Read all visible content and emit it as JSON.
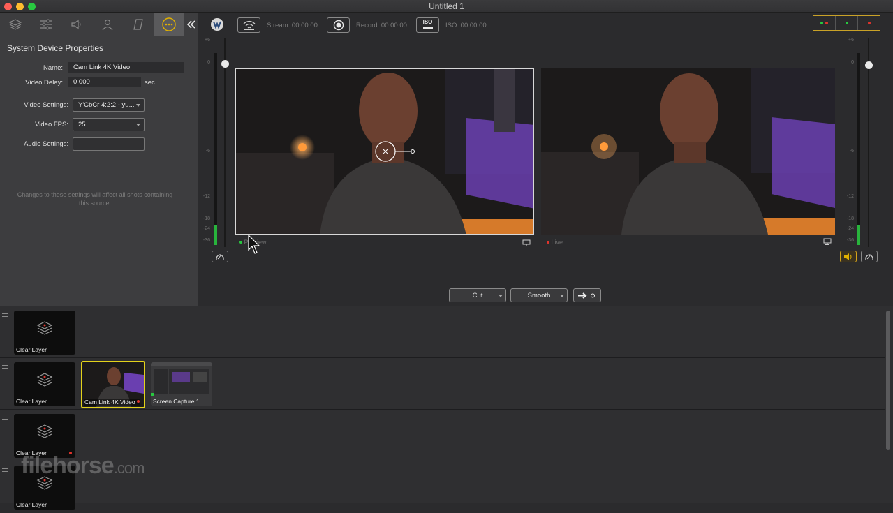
{
  "window": {
    "title": "Untitled 1"
  },
  "left_tabs": [
    {
      "icon": "layers-icon"
    },
    {
      "icon": "sliders-icon"
    },
    {
      "icon": "audio-icon"
    },
    {
      "icon": "person-icon"
    },
    {
      "icon": "overlay-icon"
    },
    {
      "icon": "more-icon",
      "active": true
    }
  ],
  "properties": {
    "title": "System Device Properties",
    "name_label": "Name:",
    "name_value": "Cam Link 4K Video",
    "delay_label": "Video Delay:",
    "delay_value": "0.000",
    "delay_unit": "sec",
    "settings_label": "Video Settings:",
    "settings_value": "Y'CbCr 4:2:2 - yu...",
    "fps_label": "Video FPS:",
    "fps_value": "25",
    "audio_label": "Audio Settings:",
    "audio_value": "",
    "note": "Changes to these settings will affect all shots containing this source."
  },
  "toolbar": {
    "stream_label": "Stream:",
    "stream_time": "00:00:00",
    "record_label": "Record:",
    "record_time": "00:00:00",
    "iso_badge": "ISO",
    "iso_label": "ISO:",
    "iso_time": "00:00:00"
  },
  "meter_scale": [
    "+6",
    "0",
    "-6",
    "-12",
    "-18",
    "-24",
    "-36"
  ],
  "preview": {
    "label": "Preview"
  },
  "live": {
    "label": "Live"
  },
  "transition": {
    "cut_label": "Cut",
    "smooth_label": "Smooth"
  },
  "layers": [
    {
      "shots": [
        {
          "label": "Clear Layer",
          "kind": "clear"
        }
      ]
    },
    {
      "shots": [
        {
          "label": "Clear Layer",
          "kind": "clear"
        },
        {
          "label": "Cam Link 4K Video",
          "kind": "camera",
          "selected": true
        },
        {
          "label": "Screen Capture 1",
          "kind": "screen"
        }
      ]
    },
    {
      "shots": [
        {
          "label": "Clear Layer",
          "kind": "clear"
        }
      ]
    },
    {
      "shots": [
        {
          "label": "Clear Layer",
          "kind": "clear"
        }
      ]
    }
  ],
  "watermark": {
    "text": "filehorse",
    "suffix": ".com"
  },
  "colors": {
    "accent": "#d4a21a",
    "meter": "#28b43c",
    "live_dot": "#e0342c",
    "preview_dot": "#28c840"
  }
}
